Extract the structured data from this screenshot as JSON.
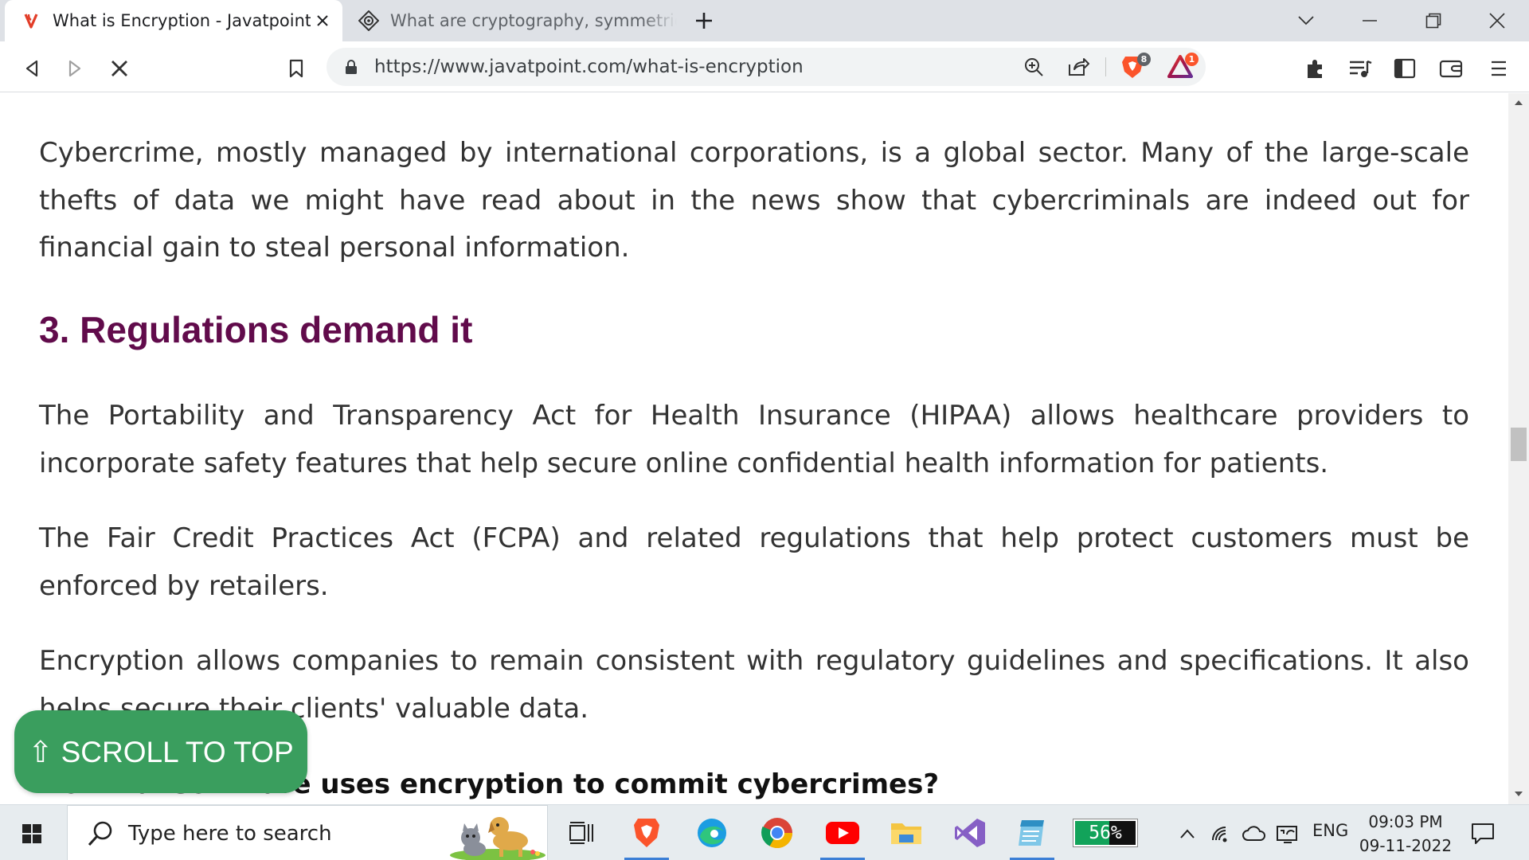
{
  "browser": {
    "tabs": [
      {
        "title": "What is Encryption - Javatpoint",
        "active": true
      },
      {
        "title": "What are cryptography, symmetric and",
        "active": false
      }
    ],
    "url": "https://www.javatpoint.com/what-is-encryption",
    "brave_shield_count": "8",
    "rewards_count": "1"
  },
  "page": {
    "para1": "Cybercrime, mostly managed by international corporations, is a global sector. Many of the large-scale thefts of data we might have read about in the news show that cybercriminals are indeed out for financial gain to steal personal information.",
    "heading": "3. Regulations demand it",
    "para2": "The Portability and Transparency Act for Health Insurance (HIPAA) allows healthcare providers to incorporate safety features that help secure online confidential health information for patients.",
    "para3": "The Fair Credit Practices Act (FCPA) and related regulations that help protect customers must be enforced by retailers.",
    "para4": "Encryption allows companies to remain consistent with regulatory guidelines and specifications. It also helps secure their clients' valuable data.",
    "subheading": "How Ransomware uses encryption to commit cybercrimes?",
    "scroll_to_top": "⇧ SCROLL TO TOP",
    "heading_color": "#610B4B",
    "scroll_button_color": "#3a9e5e"
  },
  "taskbar": {
    "search_placeholder": "Type here to search",
    "battery_percent": "56%",
    "battery_level": 0.56,
    "language": "ENG",
    "time": "09:03 PM",
    "date": "09-11-2022",
    "apps": [
      "task-view",
      "brave",
      "edge",
      "chrome",
      "youtube",
      "file-explorer",
      "visual-studio",
      "notepad"
    ]
  }
}
